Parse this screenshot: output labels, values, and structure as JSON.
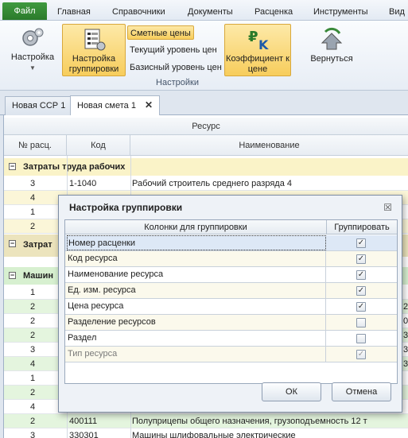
{
  "menu": [
    "Файл",
    "Главная",
    "Справочники",
    "Документы",
    "Расценка",
    "Инструменты",
    "Вид"
  ],
  "ribbon": {
    "settings": "Настройка",
    "grouping_settings": "Настройка группировки",
    "price_options": [
      "Сметные цены",
      "Текущий уровень цен",
      "Базисный уровень цен"
    ],
    "coef": "Коэффициент к цене",
    "back": "Вернуться",
    "group_label": "Настройки"
  },
  "tabs": [
    {
      "label": "Новая ССР 1"
    },
    {
      "label": "Новая смета 1",
      "close": "✕"
    }
  ],
  "grid": {
    "super_header": "Ресурс",
    "columns": [
      "№ расц.",
      "Код",
      "Наименование"
    ],
    "groups": [
      {
        "label": "Затраты труда рабочих",
        "sign": "−"
      },
      {
        "label": "Затрат",
        "sign": "−"
      },
      {
        "label": "Машин",
        "sign": "−"
      }
    ],
    "rows_top": [
      {
        "n": "3",
        "code": "1-1040",
        "name": "Рабочий строитель среднего разряда 4"
      },
      {
        "n": "4",
        "code": "",
        "name": ""
      },
      {
        "n": "1",
        "code": "",
        "name": ""
      },
      {
        "n": "2",
        "code": "",
        "name": ""
      }
    ],
    "rows_machines": [
      {
        "n": "1",
        "code": "",
        "name": ""
      },
      {
        "n": "2",
        "code": "",
        "name": ""
      },
      {
        "n": "2",
        "code": "",
        "name": ""
      },
      {
        "n": "2",
        "code": "",
        "name": ""
      },
      {
        "n": "3",
        "code": "",
        "name": ""
      },
      {
        "n": "4",
        "code": "",
        "name": ""
      },
      {
        "n": "1",
        "code": "",
        "name": ""
      },
      {
        "n": "2",
        "code": "",
        "name": ""
      },
      {
        "n": "4",
        "code": "",
        "name": ""
      },
      {
        "n": "2",
        "code": "",
        "name": "4...з... ...... ...гру..опо..мн...ь 12 т"
      },
      {
        "n": "2",
        "code": "400111",
        "name": "Полуприцепы общего назначения, грузоподъемность 12 т"
      },
      {
        "n": "3",
        "code": "330301",
        "name": "Машины шлифовальные электрические"
      }
    ],
    "right_clip": [
      "2",
      "0",
      "3",
      "3",
      "3"
    ]
  },
  "dialog": {
    "title": "Настройка группировки",
    "close": "☒",
    "col_header": "Колонки для группировки",
    "check_header": "Группировать",
    "rows": [
      {
        "label": "Номер расценки",
        "checked": true
      },
      {
        "label": "Код ресурса",
        "checked": true
      },
      {
        "label": "Наименование ресурса",
        "checked": true
      },
      {
        "label": "Ед. изм. ресурса",
        "checked": true
      },
      {
        "label": "Цена ресурса",
        "checked": true
      },
      {
        "label": "Разделение ресурсов",
        "checked": false
      },
      {
        "label": "Раздел",
        "checked": false
      },
      {
        "label": "Тип ресурса",
        "checked": true
      }
    ],
    "ok": "ОК",
    "cancel": "Отмена"
  }
}
